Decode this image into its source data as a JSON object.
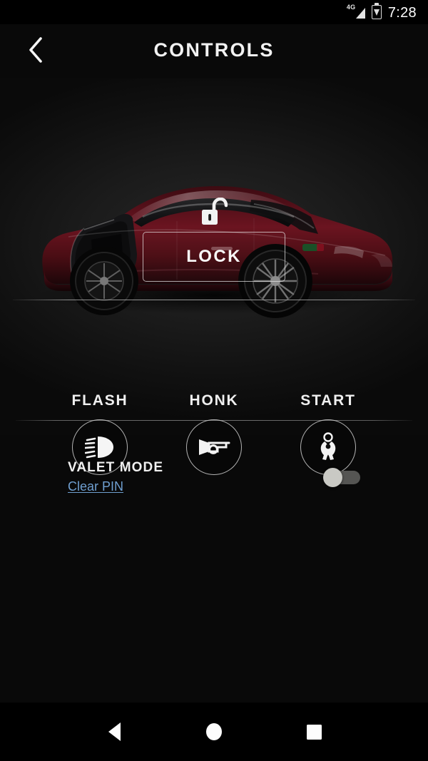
{
  "status_bar": {
    "network_label": "4G",
    "signal_icon": "signal-bars-icon",
    "battery_icon": "battery-charging-icon",
    "time": "7:28"
  },
  "header": {
    "back_icon": "chevron-left-icon",
    "title": "CONTROLS"
  },
  "vehicle": {
    "image_alt": "tesla-model-s-side-view",
    "body_color": "#4a0d14",
    "door_state": "driver-door-open"
  },
  "lock_section": {
    "status_icon": "unlocked-padlock-icon",
    "button_label": "LOCK"
  },
  "actions": [
    {
      "label": "FLASH",
      "icon": "headlight-icon"
    },
    {
      "label": "HONK",
      "icon": "horn-icon"
    },
    {
      "label": "START",
      "icon": "keys-icon"
    }
  ],
  "valet": {
    "title": "VALET MODE",
    "clear_pin_label": "Clear PIN",
    "toggle_state": "off",
    "link_color": "#6f9fd0"
  },
  "nav_bar": {
    "back_icon": "triangle-back-icon",
    "home_icon": "circle-home-icon",
    "recents_icon": "square-recents-icon"
  },
  "theme": {
    "background": "#0a0a0a",
    "text_primary": "#f2f2f2",
    "accent": "#6f9fd0"
  }
}
